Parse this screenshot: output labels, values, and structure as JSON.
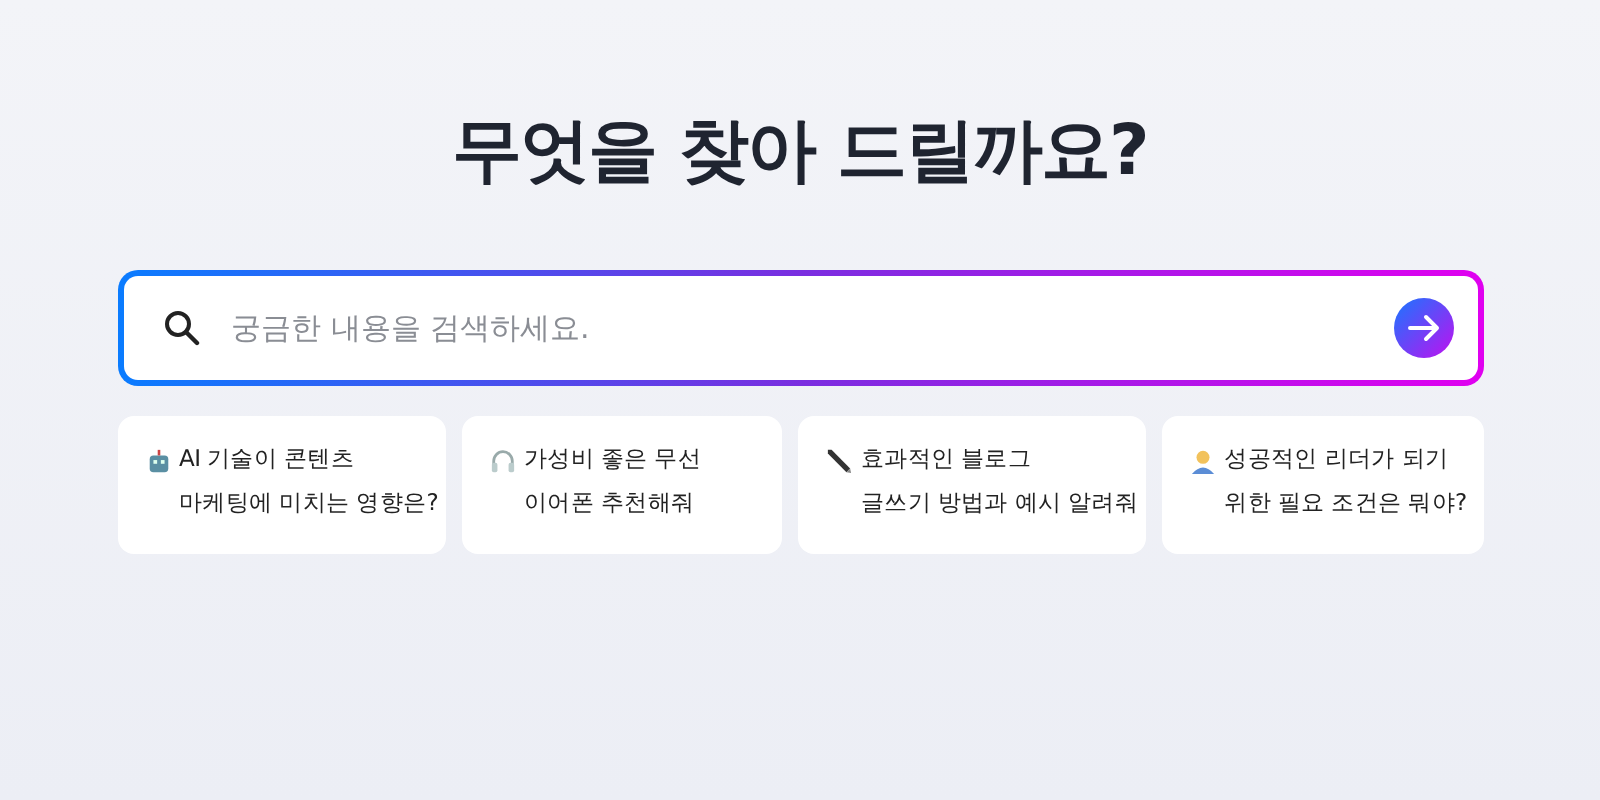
{
  "heading": "무엇을 찾아 드릴까요?",
  "search": {
    "placeholder": "궁금한 내용을 검색하세요."
  },
  "suggestions": [
    {
      "kind": "robot",
      "text": "AI 기술이 콘텐츠\n마케팅에 미치는 영향은?"
    },
    {
      "kind": "headphones",
      "text": "가성비 좋은 무선\n이어폰 추천해줘"
    },
    {
      "kind": "pen",
      "text": "효과적인 블로그\n글쓰기 방법과 예시 알려줘"
    },
    {
      "kind": "person",
      "text": "성공적인 리더가 되기\n위한 필요 조건은 뭐야?"
    }
  ]
}
